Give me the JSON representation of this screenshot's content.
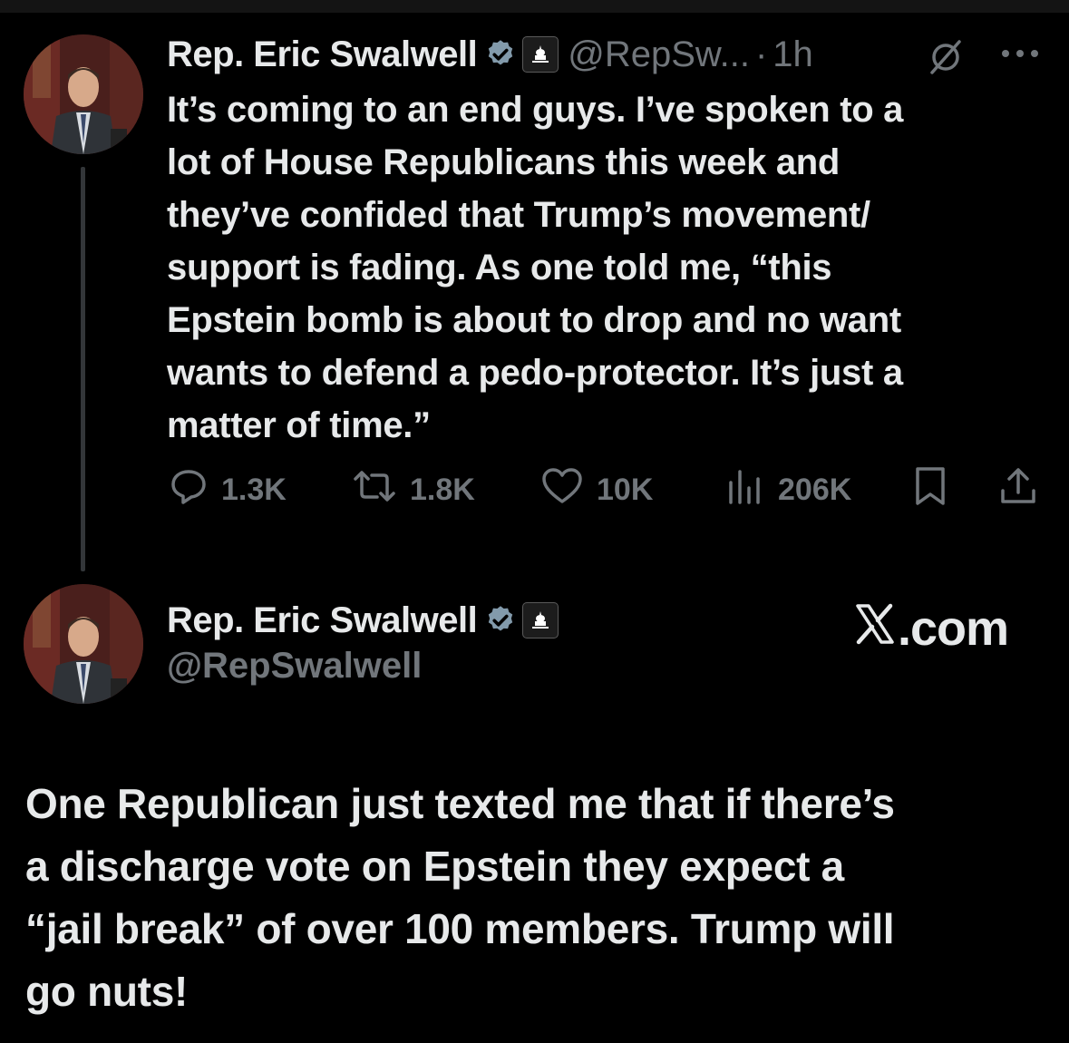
{
  "tweet": {
    "author_name": "Rep. Eric Swalwell",
    "handle_truncated": "@RepSw...",
    "separator": "·",
    "time": "1h",
    "text": "It’s coming to an end guys. I’ve spoken to a\nlot of House Republicans this week and\nthey’ve confided that Trump’s movement/\nsupport is fading. As one told me, “this\nEpstein bomb is about to drop and no want\nwants to defend a pedo-protector. It’s just a\nmatter of time.”",
    "stats": {
      "replies": "1.3K",
      "reposts": "1.8K",
      "likes": "10K",
      "views": "206K"
    }
  },
  "quoted": {
    "author_name": "Rep. Eric Swalwell",
    "handle": "@RepSwalwell",
    "site": ".com",
    "text": "One Republican just texted me that if there’s\na discharge vote on Epstein they expect a\n“jail break” of over 100 members.  Trump will\ngo nuts!"
  },
  "colors": {
    "background": "#000000",
    "text": "#e7e9ea",
    "muted": "#71767b",
    "verified": "#829aab"
  },
  "icons": [
    "verified-badge-icon",
    "government-badge-icon",
    "grok-icon",
    "more-icon",
    "reply-icon",
    "repost-icon",
    "like-icon",
    "views-icon",
    "bookmark-icon",
    "share-icon",
    "x-logo-icon"
  ]
}
